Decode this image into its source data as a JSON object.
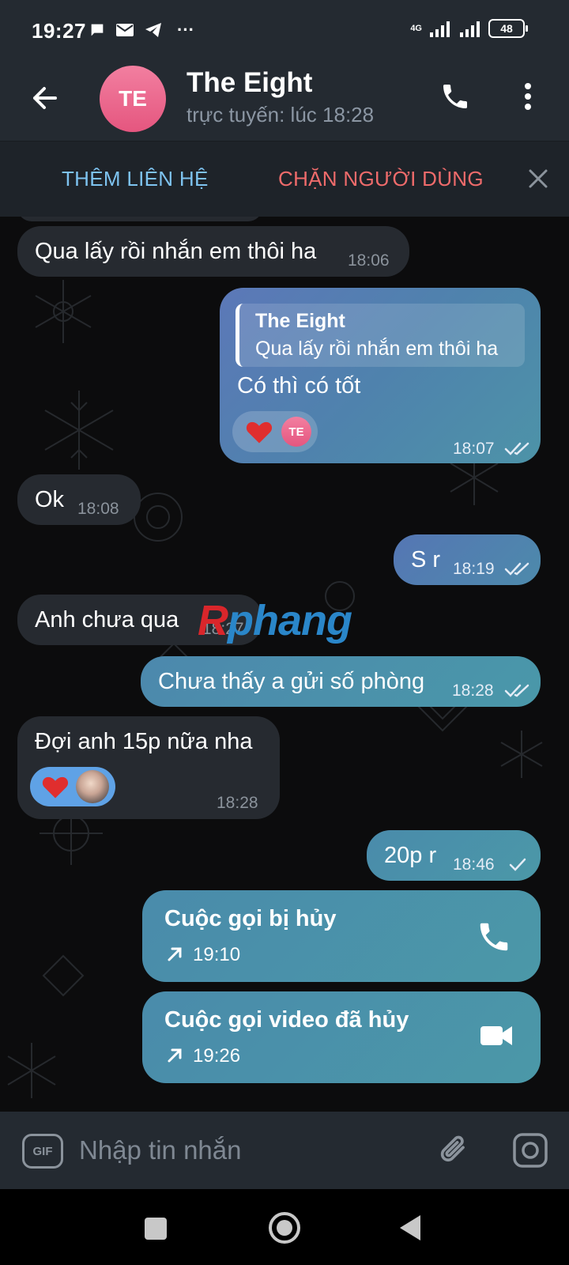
{
  "status_bar": {
    "time": "19:27",
    "more": "···",
    "network": "4G",
    "battery": "48"
  },
  "header": {
    "avatar_initials": "TE",
    "title": "The Eight",
    "subtitle": "trực tuyến: lúc 18:28"
  },
  "action_bar": {
    "add_contact": "THÊM LIÊN HỆ",
    "block_user": "CHẶN NGƯỜI DÙNG"
  },
  "messages": [
    {
      "dir": "in",
      "text": "Qua lấy rồi nhắn em thôi ha",
      "time": "18:06"
    },
    {
      "dir": "out",
      "reply_name": "The Eight",
      "reply_text": "Qua lấy rồi nhắn em thôi ha",
      "text": "Có thì có tốt",
      "reaction_initials": "TE",
      "time": "18:07",
      "status": "read"
    },
    {
      "dir": "in",
      "text": "Ok",
      "time": "18:08"
    },
    {
      "dir": "out",
      "text": "S r",
      "time": "18:19",
      "status": "read"
    },
    {
      "dir": "in",
      "text": "Anh chưa qua",
      "time": "18:27"
    },
    {
      "dir": "out",
      "text": "Chưa thấy a gửi số phòng",
      "time": "18:28",
      "status": "read"
    },
    {
      "dir": "in",
      "text": "Đợi anh 15p nữa nha",
      "time": "18:28"
    },
    {
      "dir": "out",
      "text": "20p r",
      "time": "18:46",
      "status": "sent"
    },
    {
      "dir": "out",
      "type": "call",
      "title": "Cuộc gọi bị hủy",
      "time": "19:10",
      "icon": "phone-icon"
    },
    {
      "dir": "out",
      "type": "video-call",
      "title": "Cuộc gọi video đã hủy",
      "time": "19:26",
      "icon": "video-camera-icon"
    }
  ],
  "watermark": {
    "part1": "R",
    "part2": "phang"
  },
  "composer": {
    "gif_label": "GIF",
    "placeholder": "Nhập tin nhắn"
  },
  "colors": {
    "accent_blue": "#7ec3f0",
    "danger_red": "#ef6b6b",
    "bubble_in": "#262a30",
    "bubble_out": "#5c78b8",
    "avatar_pink": "#ee6d92"
  }
}
